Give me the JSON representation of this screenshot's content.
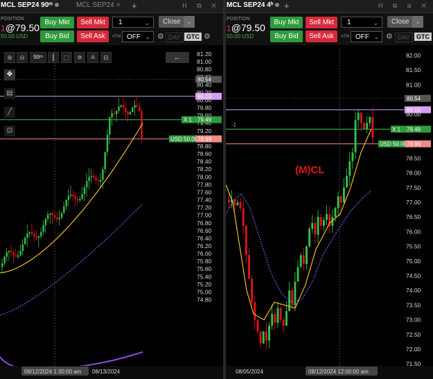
{
  "left": {
    "tab_active": "MCL SEP24 90ᵐ",
    "tab_inactive": "MCL SEP24",
    "tab_close": "×",
    "tab_add": "+",
    "tab_icons": "H ⧉ ✕",
    "position_label": "POSITION",
    "position_qty": "1",
    "position_price": "@79.50",
    "position_usd": "50.00 USD",
    "buy_mkt": "Buy Mkt",
    "sell_mkt": "Sell Mkt",
    "buy_bid": "Buy Bid",
    "sell_ask": "Sell Ask",
    "qty_value": "1",
    "close_label": "Close",
    "atm_label": "ATM",
    "atm_value": "OFF",
    "day_label": "DAY",
    "gtc_label": "GTC",
    "interval_label": "90ᵐ",
    "price_axis": [
      "81.20",
      "81.00",
      "80.80",
      "80.60",
      "80.40",
      "80.20",
      "80.00",
      "79.80",
      "79.60",
      "79.40",
      "79.20",
      "79.00",
      "78.80",
      "78.60",
      "78.40",
      "78.20",
      "78.00",
      "77.80",
      "77.60",
      "77.40",
      "77.20",
      "77.00",
      "76.80",
      "76.60",
      "76.40",
      "76.20",
      "76.00",
      "75.80",
      "75.60",
      "75.40",
      "75.20",
      "75.00",
      "74.80"
    ],
    "tag_high": "80.54",
    "tag_purple": "80.10",
    "tag_green": "79.49",
    "tag_green_prefix": "X  1",
    "tag_pink": "78.99",
    "tag_pink_prefix": "USD 50.00",
    "date_cursor": "08/12/2024 1:30:00 am",
    "date_label": "08/13/2024"
  },
  "right": {
    "tab_active": "MCL SEP24 4ʰ",
    "tab_add": "+",
    "tab_icons": "H ⧉ ⊞ ✕",
    "position_label": "POSITION",
    "position_qty": "1",
    "position_price": "@79.50",
    "position_usd": "50.00 USD",
    "buy_mkt": "Buy Mkt",
    "sell_mkt": "Sell Mkt",
    "buy_bid": "Buy Bid",
    "sell_ask": "Sell Ask",
    "qty_value": "1",
    "close_label": "Close",
    "atm_label": "ATM",
    "atm_value": "OFF",
    "day_label": "DAY",
    "gtc_label": "GTC",
    "price_axis": [
      "82.00",
      "81.50",
      "81.00",
      "80.50",
      "80.00",
      "79.50",
      "79.00",
      "78.50",
      "78.00",
      "77.50",
      "77.00",
      "76.50",
      "76.00",
      "75.50",
      "75.00",
      "74.50",
      "74.00",
      "73.50",
      "73.00",
      "72.50",
      "72.00",
      "71.50"
    ],
    "tag_high": "80.54",
    "tag_purple": "80.15",
    "tag_green": "79.49",
    "tag_green_prefix": "X  1",
    "tag_pink": "78.99",
    "tag_pink_prefix": "USD 50.00",
    "marker_text": "-1",
    "overlay_label": "(M)CL",
    "date_label": "08/05/2024",
    "date_cursor": "08/12/2024 12:00:00 am"
  },
  "colors": {
    "up": "#33c24a",
    "down": "#e0121e",
    "ma_yellow": "#f0c020",
    "dotted_purple": "#7a6cf0",
    "purple_line": "#c9a0f0",
    "green_line": "#39c45a",
    "pink_line": "#f08a9a",
    "gray_line": "#888888"
  }
}
